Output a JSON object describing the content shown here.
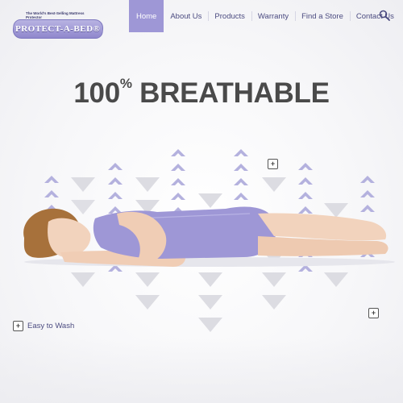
{
  "header": {
    "logo": {
      "tagline": "The World's Best-Selling Mattress Protector",
      "brand": "PROTECT-A-BED®"
    },
    "nav": [
      {
        "label": "Home",
        "active": true
      },
      {
        "label": "About Us",
        "active": false
      },
      {
        "label": "Products",
        "active": false
      },
      {
        "label": "Warranty",
        "active": false
      },
      {
        "label": "Find a Store",
        "active": false
      },
      {
        "label": "Contact Us",
        "active": false
      }
    ],
    "search_icon": "search-icon"
  },
  "hero": {
    "headline_number": "100",
    "headline_percent": "%",
    "headline_text": " BREATHABLE",
    "hotspots": [
      {
        "symbol": "+",
        "label": ""
      },
      {
        "symbol": "+",
        "label": "Easy to Wash"
      },
      {
        "symbol": "+",
        "label": ""
      }
    ]
  },
  "colors": {
    "accent": "#9e97d6",
    "nav_text": "#4b4b80",
    "headline": "#4a4a4a",
    "arrow_up": "#b4b1de",
    "arrow_down": "#d9d9de"
  }
}
